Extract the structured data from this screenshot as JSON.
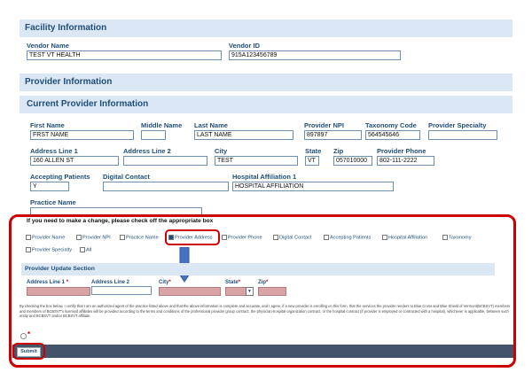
{
  "facility": {
    "header": "Facility Information",
    "vendor_name_label": "Vendor Name",
    "vendor_name_value": "TEST VT HEALTH",
    "vendor_id_label": "Vendor ID",
    "vendor_id_value": "915A123456789"
  },
  "provider_info_header": "Provider Information",
  "current_provider_header": "Current Provider Information",
  "fields": {
    "first_name_label": "First Name",
    "first_name_value": "FRST NAME",
    "middle_name_label": "Middle Name",
    "middle_name_value": "",
    "last_name_label": "Last Name",
    "last_name_value": "LAST NAME",
    "npi_label": "Provider NPI",
    "npi_value": "897897",
    "taxonomy_label": "Taxonomy Code",
    "taxonomy_value": "564545646",
    "specialty_label": "Provider Specialty",
    "specialty_value": "",
    "addr1_label": "Address Line 1",
    "addr1_value": "160 ALLEN ST",
    "addr2_label": "Address Line 2",
    "addr2_value": "",
    "city_label": "City",
    "city_value": "TEST",
    "state_label": "State",
    "state_value": "VT",
    "zip_label": "Zip",
    "zip_value": "057010000",
    "phone_label": "Provider Phone",
    "phone_value": "802-111-2222",
    "accepting_label": "Accepting Patients",
    "accepting_value": "Y",
    "digital_label": "Digital Contact",
    "digital_value": "",
    "hospital_label": "Hospital Affiliation 1",
    "hospital_value": "HOSPITAL AFFILIATION",
    "practice_label": "Practice Name",
    "practice_value": ""
  },
  "change": {
    "prompt": "If you need to make a change, please check off the appropriate box",
    "options": [
      {
        "label": "Provider Name",
        "checked": false
      },
      {
        "label": "Provider NPI",
        "checked": false
      },
      {
        "label": "Practice Name",
        "checked": false
      },
      {
        "label": "Provider Address",
        "checked": true
      },
      {
        "label": "Provider Phone",
        "checked": false
      },
      {
        "label": "Digital Contact",
        "checked": false
      },
      {
        "label": "Accepting Patients",
        "checked": false
      },
      {
        "label": "Hospital Affiliation",
        "checked": false
      },
      {
        "label": "Taxonomy",
        "checked": false
      },
      {
        "label": "Provider Specialty",
        "checked": false
      },
      {
        "label": "All",
        "checked": false
      }
    ]
  },
  "update": {
    "header": "Provider Update Section",
    "addr1_label": "Address Line 1",
    "addr2_label": "Address Line 2",
    "city_label": "City",
    "state_label": "State",
    "zip_label": "Zip",
    "required_mark": "*"
  },
  "certification": "By checking the box below, I certify that I am an authorized agent of the practice listed above and that the above information is complete and accurate, and I agree, if a new provider is enrolling on this form, that the services the provider renders to Blue Cross and Blue Shield of Vermont(BCBSVT) members and members of BCBSVT's licensed affiliates will be provided according to the terms and conditions of the professional provider group contract, the physician-hospital organization contract, or the hospital contract (if provider is employed or contracted with a hospital), whichever is applicable, between such entity and BCBSVT and/or BCBSVT affiliate.",
  "agree_required_mark": "*",
  "submit_label": "Submit",
  "colors": {
    "header_bg": "#dbe7f4",
    "label": "#1f4e79",
    "highlight_red": "#cc0000",
    "arrow_blue": "#4472c4",
    "required_field": "#d9a3a5",
    "footer_bar": "#44546a"
  }
}
